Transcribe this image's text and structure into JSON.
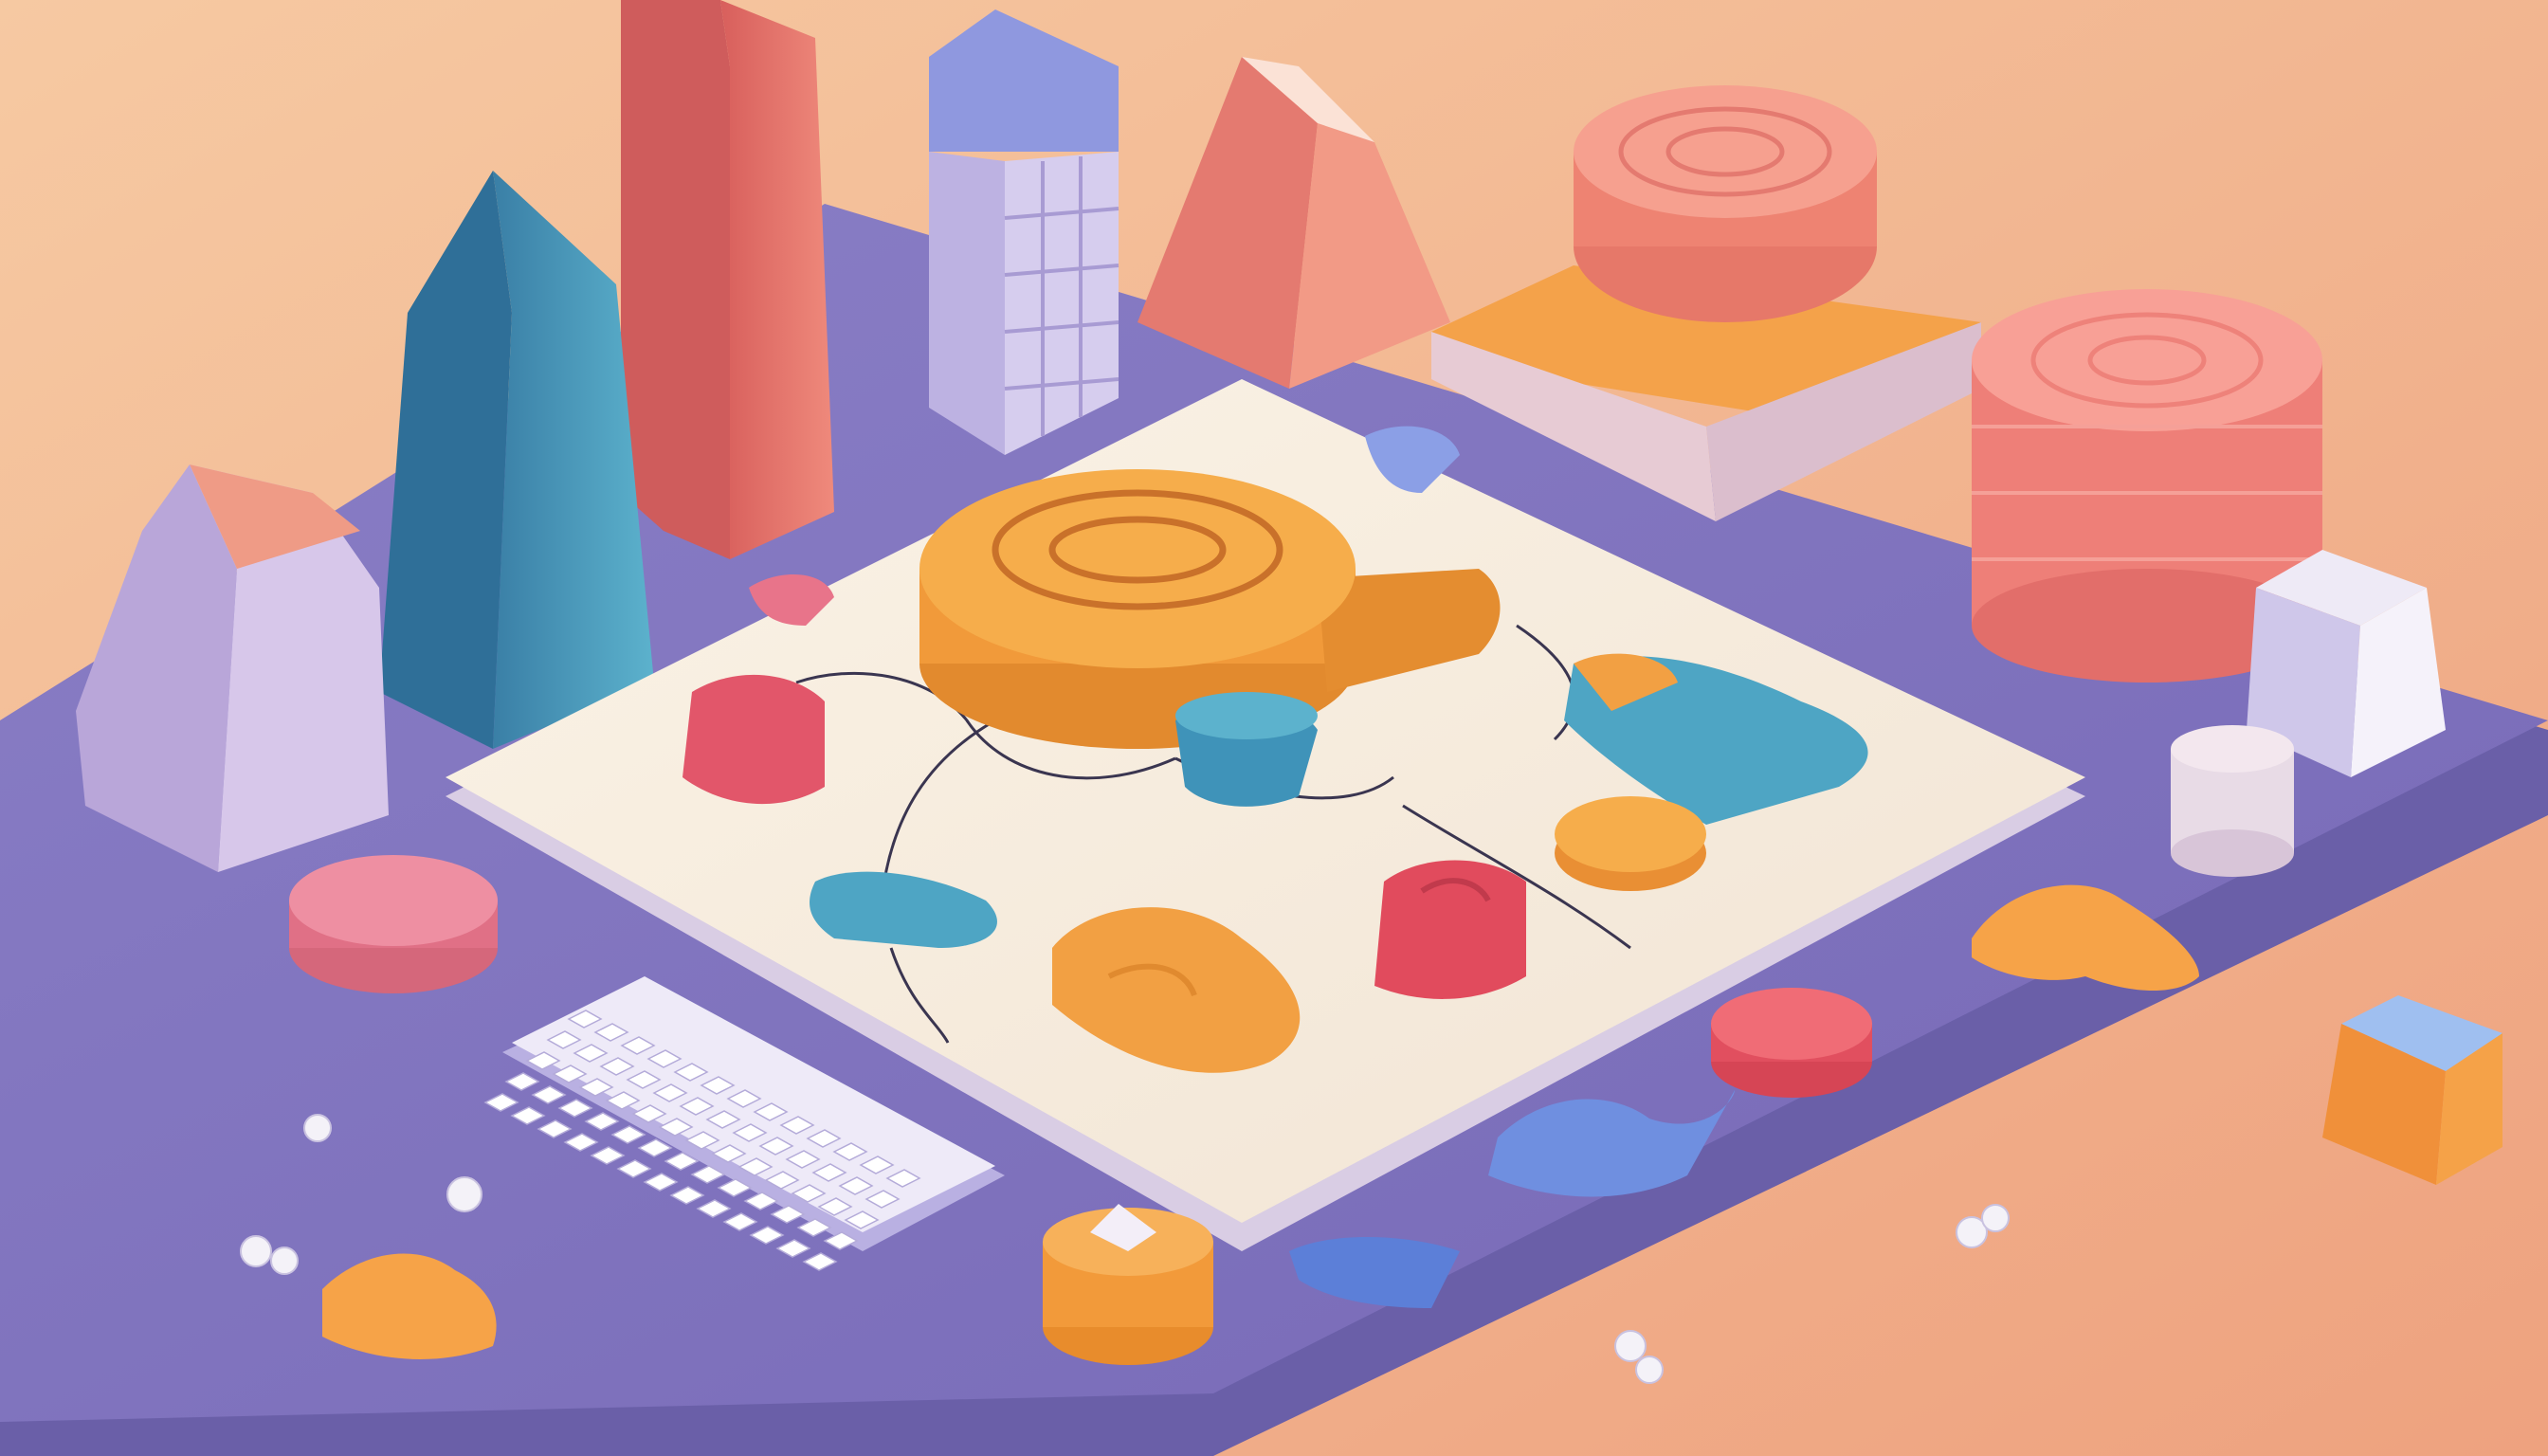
{
  "scene": {
    "palette": {
      "background_light": "#f6c9a2",
      "background_dark": "#eea27f",
      "platform": "#7f73bd",
      "platform_edge": "#6a5fa8",
      "board": "#f6ebdc",
      "orange": "#f2a043",
      "coral": "#ee8178",
      "red": "#e15563",
      "teal": "#4ea5c4",
      "blue": "#6f8fe0",
      "lavender": "#c9bde6",
      "pink": "#e9849a",
      "white": "#f3f0f6"
    },
    "elements": {
      "platform": "isometric-base-platform",
      "board": "puzzle-board",
      "keyboard": "keyboard",
      "centerpiece": "orange-spiral-token",
      "towers": [
        "coral-tower",
        "teal-crystal",
        "lavender-rock",
        "grid-building",
        "coral-pyramid"
      ],
      "cylinders": [
        "orange-block-with-spiral",
        "coral-drum",
        "pink-disc",
        "red-disc",
        "orange-cup"
      ]
    }
  }
}
